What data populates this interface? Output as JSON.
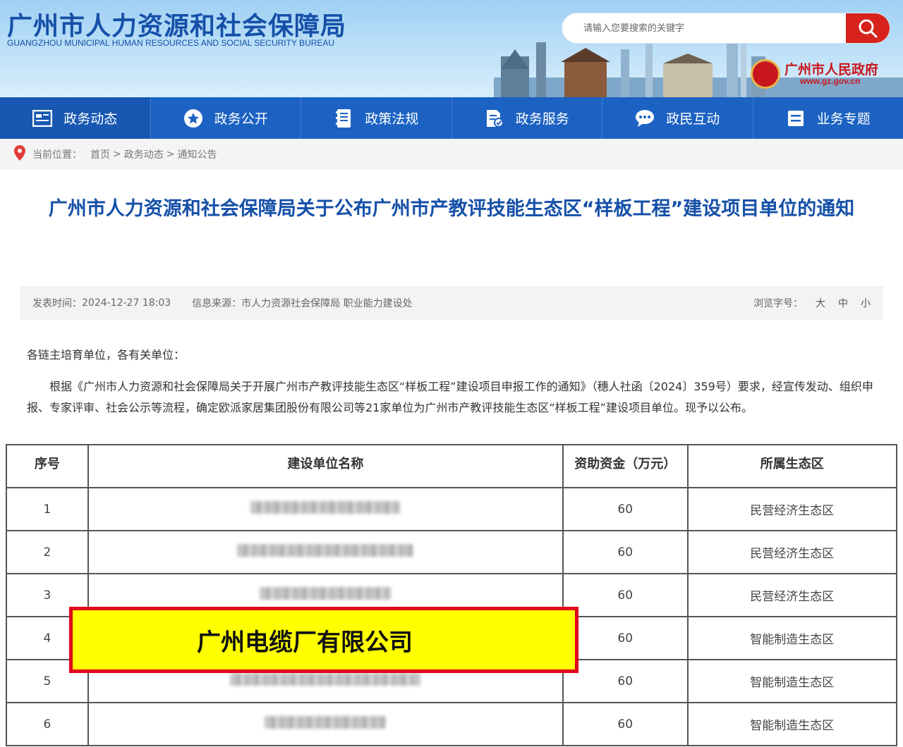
{
  "header": {
    "title": "广州市人力资源和社会保障局",
    "subtitle": "GUANGZHOU MUNICIPAL HUMAN RESOURCES AND SOCIAL SECURITY BUREAU",
    "search_placeholder": "请输入您要搜索的关键字",
    "gov_name": "广州市人民政府",
    "gov_url": "www.gz.gov.cn"
  },
  "nav": {
    "items": [
      {
        "label": "政务动态",
        "icon": "news-icon"
      },
      {
        "label": "政务公开",
        "icon": "star-icon"
      },
      {
        "label": "政策法规",
        "icon": "book-icon"
      },
      {
        "label": "政务服务",
        "icon": "service-icon"
      },
      {
        "label": "政民互动",
        "icon": "chat-icon"
      },
      {
        "label": "业务专题",
        "icon": "list-icon"
      }
    ]
  },
  "breadcrumb": {
    "prefix": "当前位置：",
    "items": [
      "首页",
      "政务动态",
      "通知公告"
    ],
    "sep": ">"
  },
  "article": {
    "title": "广州市人力资源和社会保障局关于公布广州市产教评技能生态区“样板工程”建设项目单位的通知",
    "publish_label": "发表时间：",
    "publish_time": "2024-12-27 18:03",
    "source_label": "信息来源：",
    "source": "市人力资源社会保障局 职业能力建设处",
    "font_label": "浏览字号：",
    "font_sizes": [
      "大",
      "中",
      "小"
    ],
    "greeting": "各链主培育单位，各有关单位：",
    "body": "根据《广州市人力资源和社会保障局关于开展广州市产教评技能生态区“样板工程”建设项目申报工作的通知》（穗人社函〔2024〕359号）要求，经宣传发动、组织申报、专家评审、社会公示等流程，确定欧派家居集团股份有限公司等21家单位为广州市产教评技能生态区“样板工程”建设项目单位。现予以公布。"
  },
  "table": {
    "headers": [
      "序号",
      "建设单位名称",
      "资助资金（万元）",
      "所属生态区"
    ],
    "rows": [
      {
        "no": "1",
        "fund": "60",
        "zone": "民营经济生态区"
      },
      {
        "no": "2",
        "fund": "60",
        "zone": "民营经济生态区"
      },
      {
        "no": "3",
        "fund": "60",
        "zone": "民营经济生态区"
      },
      {
        "no": "4",
        "fund": "60",
        "zone": "智能制造生态区"
      },
      {
        "no": "5",
        "fund": "60",
        "zone": "智能制造生态区"
      },
      {
        "no": "6",
        "fund": "60",
        "zone": "智能制造生态区"
      }
    ]
  },
  "highlight": {
    "text": "广州电缆厂有限公司"
  },
  "colors": {
    "brand_blue": "#1550a8",
    "nav_blue": "#1c62c2",
    "search_red": "#d7231c",
    "highlight_yellow": "#ffff00",
    "highlight_border": "#e2001a"
  }
}
